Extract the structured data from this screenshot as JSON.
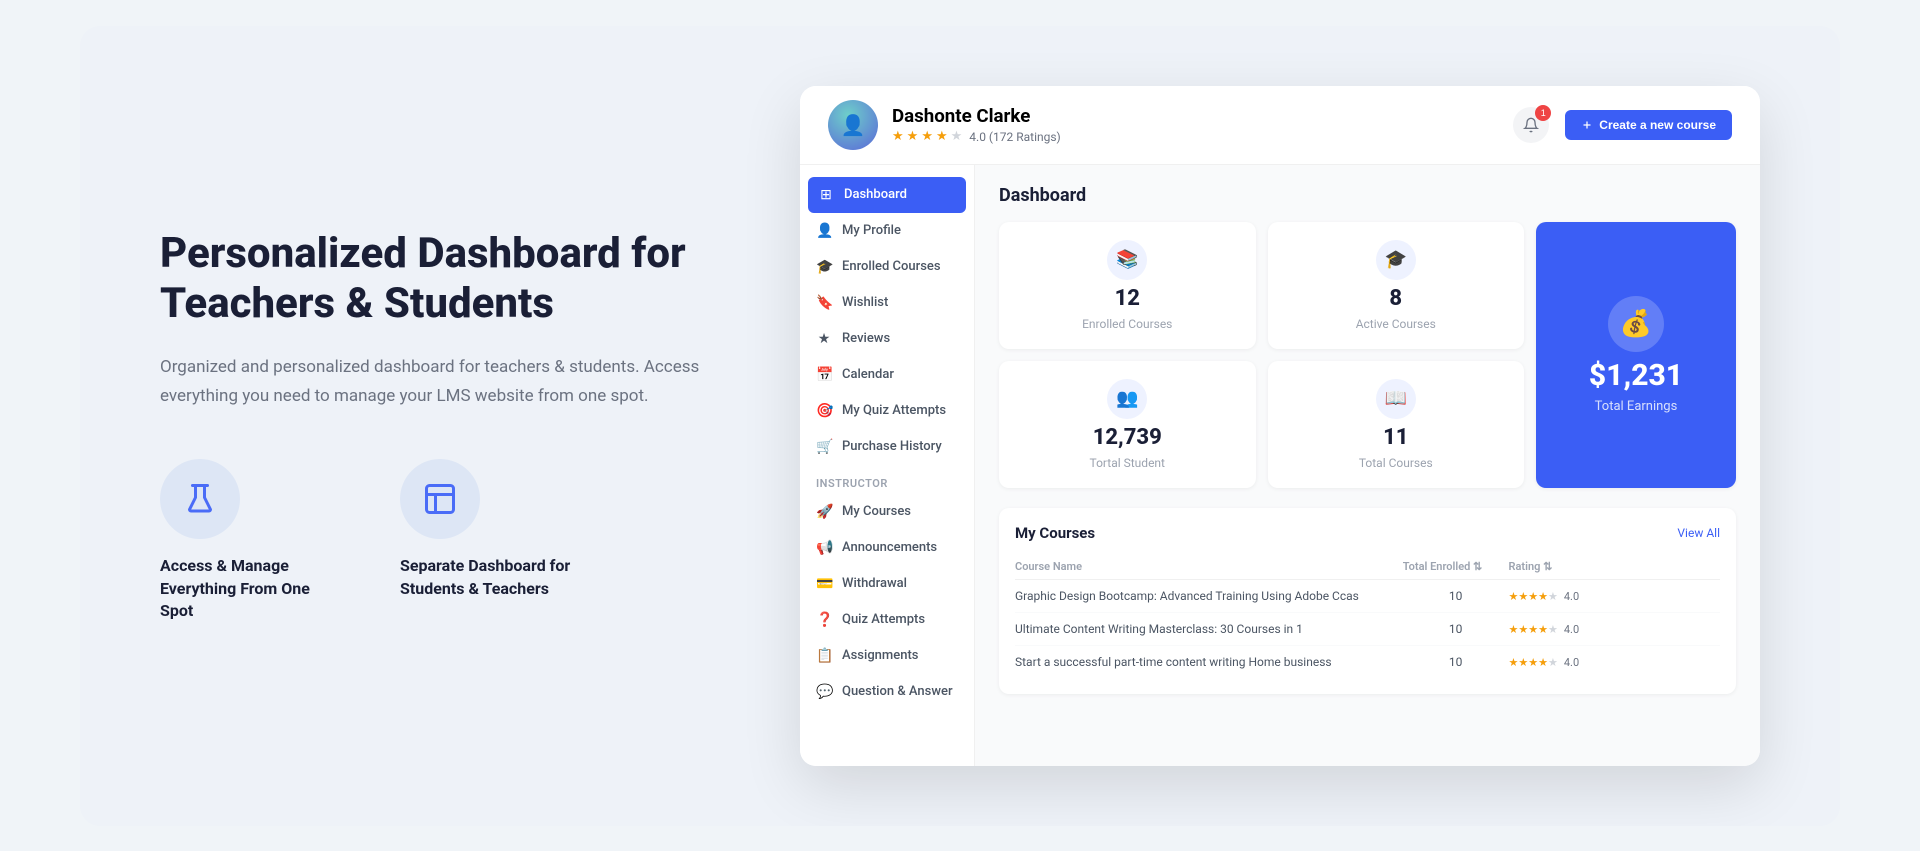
{
  "page": {
    "background": "#eef2f8"
  },
  "hero": {
    "title": "Personalized Dashboard for Teachers & Students",
    "description": "Organized and personalized dashboard for teachers & students. Access everything you need to manage your LMS website from one spot.",
    "features": [
      {
        "id": "feature-access",
        "label": "Access & Manage Everything From One Spot",
        "icon": "flask-icon"
      },
      {
        "id": "feature-separate",
        "label": "Separate Dashboard for Students & Teachers",
        "icon": "layout-icon"
      }
    ]
  },
  "dashboard": {
    "header": {
      "user": {
        "name": "Dashonte Clarke",
        "rating": 4.0,
        "rating_count": "172 Ratings",
        "stars": [
          true,
          true,
          true,
          true,
          false
        ]
      },
      "notification_count": "1",
      "create_button_label": "Create a new course"
    },
    "sidebar": {
      "student_items": [
        {
          "id": "dashboard",
          "label": "Dashboard",
          "active": true
        },
        {
          "id": "my-profile",
          "label": "My Profile",
          "active": false
        },
        {
          "id": "enrolled-courses",
          "label": "Enrolled Courses",
          "active": false
        },
        {
          "id": "wishlist",
          "label": "Wishlist",
          "active": false
        },
        {
          "id": "reviews",
          "label": "Reviews",
          "active": false
        },
        {
          "id": "calendar",
          "label": "Calendar",
          "active": false
        },
        {
          "id": "quiz-attempts",
          "label": "My Quiz Attempts",
          "active": false
        },
        {
          "id": "purchase-history",
          "label": "Purchase History",
          "active": false
        }
      ],
      "instructor_label": "Instructor",
      "instructor_items": [
        {
          "id": "my-courses",
          "label": "My Courses",
          "active": false
        },
        {
          "id": "announcements",
          "label": "Announcements",
          "active": false
        },
        {
          "id": "withdrawal",
          "label": "Withdrawal",
          "active": false
        },
        {
          "id": "quiz-attempts-inst",
          "label": "Quiz Attempts",
          "active": false
        },
        {
          "id": "assignments",
          "label": "Assignments",
          "active": false
        },
        {
          "id": "question-answer",
          "label": "Question & Answer",
          "active": false
        }
      ]
    },
    "main": {
      "title": "Dashboard",
      "stats": [
        {
          "id": "enrolled",
          "number": "12",
          "label": "Enrolled Courses",
          "icon": "book-icon"
        },
        {
          "id": "active",
          "number": "8",
          "label": "Active Courses",
          "icon": "graduation-icon"
        },
        {
          "id": "students",
          "number": "12,739",
          "label": "Tortal Student",
          "icon": "students-icon"
        },
        {
          "id": "total-courses",
          "number": "11",
          "label": "Total Courses",
          "icon": "courses-icon"
        },
        {
          "id": "earnings",
          "number": "$1,231",
          "label": "Total Earnings",
          "icon": "earnings-icon",
          "highlight": true
        }
      ],
      "my_courses": {
        "title": "My Courses",
        "view_all": "View All",
        "table_headers": {
          "course_name": "Course Name",
          "total_enrolled": "Total Enrolled",
          "enrolled_indicator": "⇅",
          "rating": "Rating",
          "rating_indicator": "⇅"
        },
        "courses": [
          {
            "id": "course-1",
            "name": "Graphic Design Bootcamp: Advanced Training Using Adobe Ccas",
            "enrolled": "10",
            "rating": 4.0,
            "stars": [
              true,
              true,
              true,
              true,
              false
            ]
          },
          {
            "id": "course-2",
            "name": "Ultimate Content Writing Masterclass: 30 Courses in 1",
            "enrolled": "10",
            "rating": 4.0,
            "stars": [
              true,
              true,
              true,
              true,
              false
            ]
          },
          {
            "id": "course-3",
            "name": "Start a successful part-time content writing Home business",
            "enrolled": "10",
            "rating": 4.0,
            "stars": [
              true,
              true,
              true,
              true,
              false
            ]
          }
        ]
      }
    }
  }
}
